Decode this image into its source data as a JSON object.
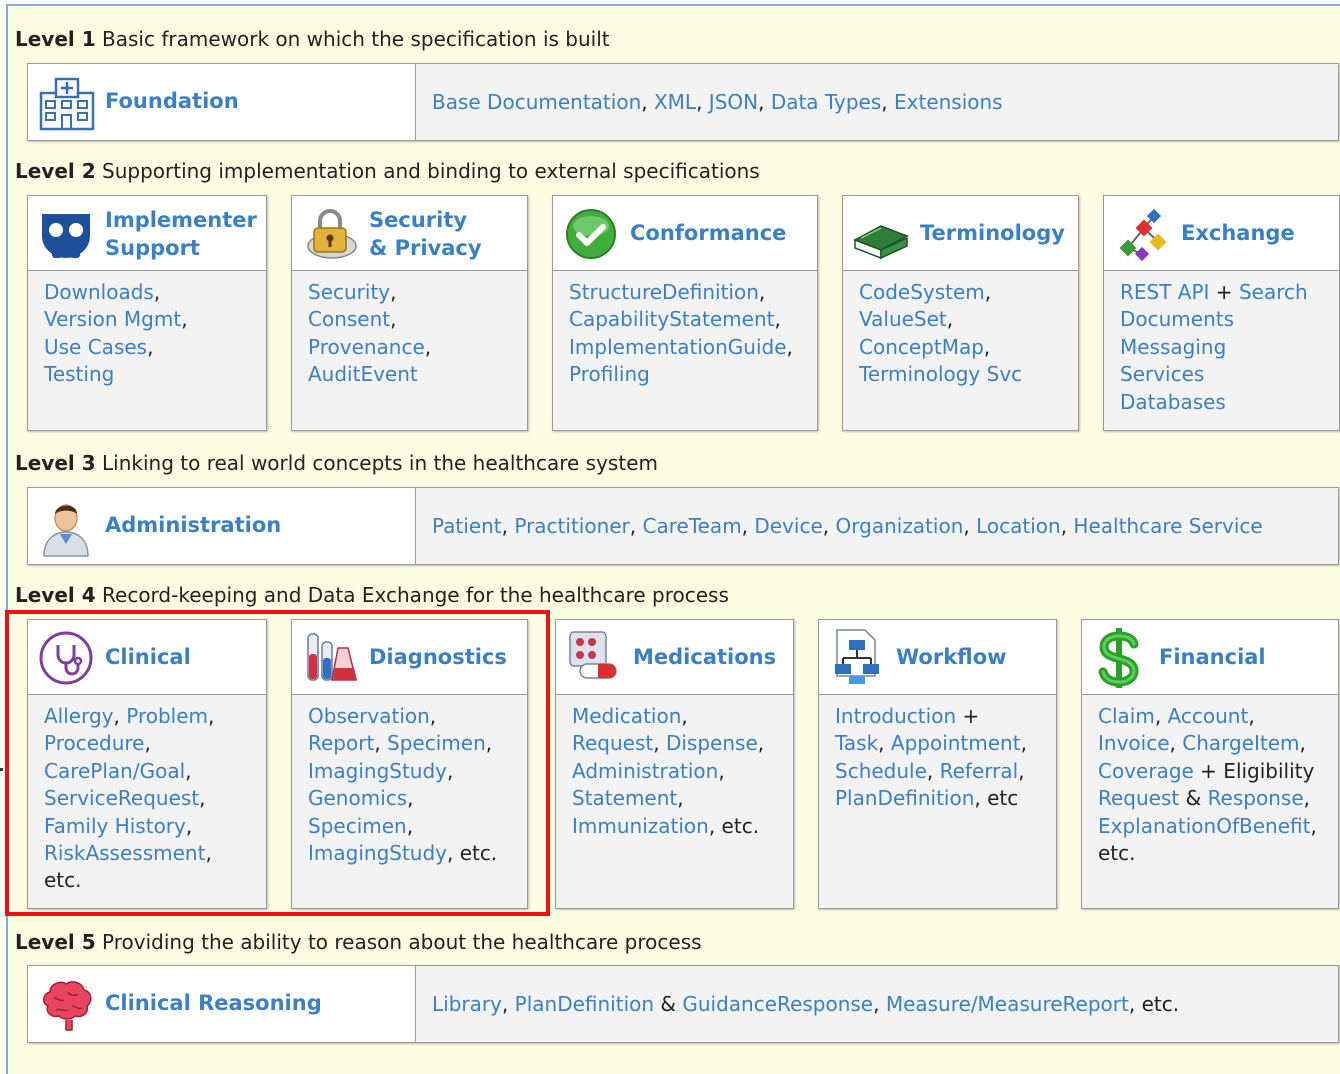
{
  "levels": [
    {
      "num": "Level 1",
      "desc": "Basic framework on which the specification is built"
    },
    {
      "num": "Level 2",
      "desc": "Supporting implementation and binding to external specifications"
    },
    {
      "num": "Level 3",
      "desc": "Linking to real world concepts in the healthcare system"
    },
    {
      "num": "Level 4",
      "desc": "Record-keeping and Data Exchange for the healthcare process"
    },
    {
      "num": "Level 5",
      "desc": "Providing the ability to reason about the healthcare process"
    }
  ],
  "foundation": {
    "title": "Foundation",
    "links": [
      {
        "t": "Base Documentation",
        "l": true
      },
      {
        "t": ", ",
        "l": false
      },
      {
        "t": "XML",
        "l": true
      },
      {
        "t": ", ",
        "l": false
      },
      {
        "t": "JSON",
        "l": true
      },
      {
        "t": ", ",
        "l": false
      },
      {
        "t": "Data Types",
        "l": true
      },
      {
        "t": ", ",
        "l": false
      },
      {
        "t": "Extensions",
        "l": true
      }
    ]
  },
  "level2": [
    {
      "title1": "Implementer",
      "title2": "Support",
      "icon": "implementer-icon",
      "lines": [
        [
          {
            "t": "Downloads",
            "l": true
          },
          {
            "t": ",",
            "l": false
          }
        ],
        [
          {
            "t": "Version Mgmt",
            "l": true
          },
          {
            "t": ",",
            "l": false
          }
        ],
        [
          {
            "t": "Use Cases",
            "l": true
          },
          {
            "t": ",",
            "l": false
          }
        ],
        [
          {
            "t": "Testing",
            "l": true
          }
        ]
      ]
    },
    {
      "title1": "Security",
      "title2": "& Privacy",
      "icon": "padlock-icon",
      "lines": [
        [
          {
            "t": "Security",
            "l": true
          },
          {
            "t": ",",
            "l": false
          }
        ],
        [
          {
            "t": "Consent",
            "l": true
          },
          {
            "t": ",",
            "l": false
          }
        ],
        [
          {
            "t": "Provenance",
            "l": true
          },
          {
            "t": ",",
            "l": false
          }
        ],
        [
          {
            "t": "AuditEvent",
            "l": true
          }
        ]
      ]
    },
    {
      "title1": "Conformance",
      "title2": "",
      "icon": "checkmark-icon",
      "lines": [
        [
          {
            "t": "StructureDefinition",
            "l": true
          },
          {
            "t": ",",
            "l": false
          }
        ],
        [
          {
            "t": "CapabilityStatement",
            "l": true
          },
          {
            "t": ",",
            "l": false
          }
        ],
        [
          {
            "t": "ImplementationGuide",
            "l": true
          },
          {
            "t": ",",
            "l": false
          }
        ],
        [
          {
            "t": "Profiling",
            "l": true
          }
        ]
      ]
    },
    {
      "title1": "Terminology",
      "title2": "",
      "icon": "book-icon",
      "lines": [
        [
          {
            "t": "CodeSystem",
            "l": true
          },
          {
            "t": ",",
            "l": false
          }
        ],
        [
          {
            "t": "ValueSet",
            "l": true
          },
          {
            "t": ",",
            "l": false
          }
        ],
        [
          {
            "t": "ConceptMap",
            "l": true
          },
          {
            "t": ",",
            "l": false
          }
        ],
        [
          {
            "t": "Terminology Svc",
            "l": true
          }
        ]
      ]
    },
    {
      "title1": "Exchange",
      "title2": "",
      "icon": "network-icon",
      "lines": [
        [
          {
            "t": "REST API",
            "l": true
          },
          {
            "t": " + ",
            "l": false
          },
          {
            "t": "Search",
            "l": true
          }
        ],
        [
          {
            "t": "Documents",
            "l": true
          }
        ],
        [
          {
            "t": "Messaging",
            "l": true
          }
        ],
        [
          {
            "t": "Services",
            "l": true
          }
        ],
        [
          {
            "t": "Databases",
            "l": true
          }
        ]
      ]
    }
  ],
  "administration": {
    "title": "Administration",
    "links": [
      {
        "t": "Patient",
        "l": true
      },
      {
        "t": ", ",
        "l": false
      },
      {
        "t": "Practitioner",
        "l": true
      },
      {
        "t": ", ",
        "l": false
      },
      {
        "t": "CareTeam",
        "l": true
      },
      {
        "t": ", ",
        "l": false
      },
      {
        "t": "Device",
        "l": true
      },
      {
        "t": ", ",
        "l": false
      },
      {
        "t": "Organization",
        "l": true
      },
      {
        "t": ", ",
        "l": false
      },
      {
        "t": "Location",
        "l": true
      },
      {
        "t": ", ",
        "l": false
      },
      {
        "t": "Healthcare Service",
        "l": true
      }
    ]
  },
  "level4": [
    {
      "title1": "Clinical",
      "icon": "stethoscope-icon",
      "lines": [
        [
          {
            "t": "Allergy",
            "l": true
          },
          {
            "t": ", ",
            "l": false
          },
          {
            "t": "Problem",
            "l": true
          },
          {
            "t": ",",
            "l": false
          }
        ],
        [
          {
            "t": "Procedure",
            "l": true
          },
          {
            "t": ",",
            "l": false
          }
        ],
        [
          {
            "t": "CarePlan/Goal",
            "l": true
          },
          {
            "t": ",",
            "l": false
          }
        ],
        [
          {
            "t": "ServiceRequest",
            "l": true
          },
          {
            "t": ",",
            "l": false
          }
        ],
        [
          {
            "t": "Family History",
            "l": true
          },
          {
            "t": ",",
            "l": false
          }
        ],
        [
          {
            "t": "RiskAssessment",
            "l": true
          },
          {
            "t": ",",
            "l": false
          }
        ],
        [
          {
            "t": "etc.",
            "l": false
          }
        ]
      ]
    },
    {
      "title1": "Diagnostics",
      "icon": "test-tubes-icon",
      "lines": [
        [
          {
            "t": "Observation",
            "l": true
          },
          {
            "t": ",",
            "l": false
          }
        ],
        [
          {
            "t": "Report",
            "l": true
          },
          {
            "t": ", ",
            "l": false
          },
          {
            "t": "Specimen",
            "l": true
          },
          {
            "t": ",",
            "l": false
          }
        ],
        [
          {
            "t": "ImagingStudy",
            "l": true
          },
          {
            "t": ",",
            "l": false
          }
        ],
        [
          {
            "t": "Genomics",
            "l": true
          },
          {
            "t": ",",
            "l": false
          }
        ],
        [
          {
            "t": "Specimen",
            "l": true
          },
          {
            "t": ",",
            "l": false
          }
        ],
        [
          {
            "t": "ImagingStudy",
            "l": true
          },
          {
            "t": ", etc.",
            "l": false
          }
        ]
      ]
    },
    {
      "title1": "Medications",
      "icon": "pills-icon",
      "lines": [
        [
          {
            "t": "Medication",
            "l": true
          },
          {
            "t": ",",
            "l": false
          }
        ],
        [
          {
            "t": "Request",
            "l": true
          },
          {
            "t": ", ",
            "l": false
          },
          {
            "t": "Dispense",
            "l": true
          },
          {
            "t": ",",
            "l": false
          }
        ],
        [
          {
            "t": "Administration",
            "l": true
          },
          {
            "t": ",",
            "l": false
          }
        ],
        [
          {
            "t": "Statement",
            "l": true
          },
          {
            "t": ",",
            "l": false
          }
        ],
        [
          {
            "t": "Immunization",
            "l": true
          },
          {
            "t": ", etc.",
            "l": false
          }
        ]
      ]
    },
    {
      "title1": "Workflow",
      "icon": "flowchart-icon",
      "lines": [
        [
          {
            "t": "Introduction",
            "l": true
          },
          {
            "t": " +",
            "l": false
          }
        ],
        [
          {
            "t": "Task",
            "l": true
          },
          {
            "t": ", ",
            "l": false
          },
          {
            "t": "Appointment",
            "l": true
          },
          {
            "t": ",",
            "l": false
          }
        ],
        [
          {
            "t": "Schedule",
            "l": true
          },
          {
            "t": ", ",
            "l": false
          },
          {
            "t": "Referral",
            "l": true
          },
          {
            "t": ",",
            "l": false
          }
        ],
        [
          {
            "t": "PlanDefinition",
            "l": true
          },
          {
            "t": ", etc",
            "l": false
          }
        ]
      ]
    },
    {
      "title1": "Financial",
      "icon": "dollar-icon",
      "lines": [
        [
          {
            "t": "Claim",
            "l": true
          },
          {
            "t": ", ",
            "l": false
          },
          {
            "t": "Account",
            "l": true
          },
          {
            "t": ",",
            "l": false
          }
        ],
        [
          {
            "t": "Invoice",
            "l": true
          },
          {
            "t": ", ",
            "l": false
          },
          {
            "t": "ChargeItem",
            "l": true
          },
          {
            "t": ",",
            "l": false
          }
        ],
        [
          {
            "t": "Coverage",
            "l": true
          },
          {
            "t": " + Eligibility",
            "l": false
          }
        ],
        [
          {
            "t": "Request",
            "l": true
          },
          {
            "t": " & ",
            "l": false
          },
          {
            "t": "Response",
            "l": true
          },
          {
            "t": ",",
            "l": false
          }
        ],
        [
          {
            "t": "ExplanationOfBenefit",
            "l": true
          },
          {
            "t": ",",
            "l": false
          }
        ],
        [
          {
            "t": "etc.",
            "l": false
          }
        ]
      ]
    }
  ],
  "reasoning": {
    "title": "Clinical Reasoning",
    "links": [
      {
        "t": "Library",
        "l": true
      },
      {
        "t": ", ",
        "l": false
      },
      {
        "t": "PlanDefinition",
        "l": true
      },
      {
        "t": " & ",
        "l": false
      },
      {
        "t": "GuidanceResponse",
        "l": true
      },
      {
        "t": ", ",
        "l": false
      },
      {
        "t": "Measure/MeasureReport",
        "l": true
      },
      {
        "t": ", etc.",
        "l": false
      }
    ]
  }
}
